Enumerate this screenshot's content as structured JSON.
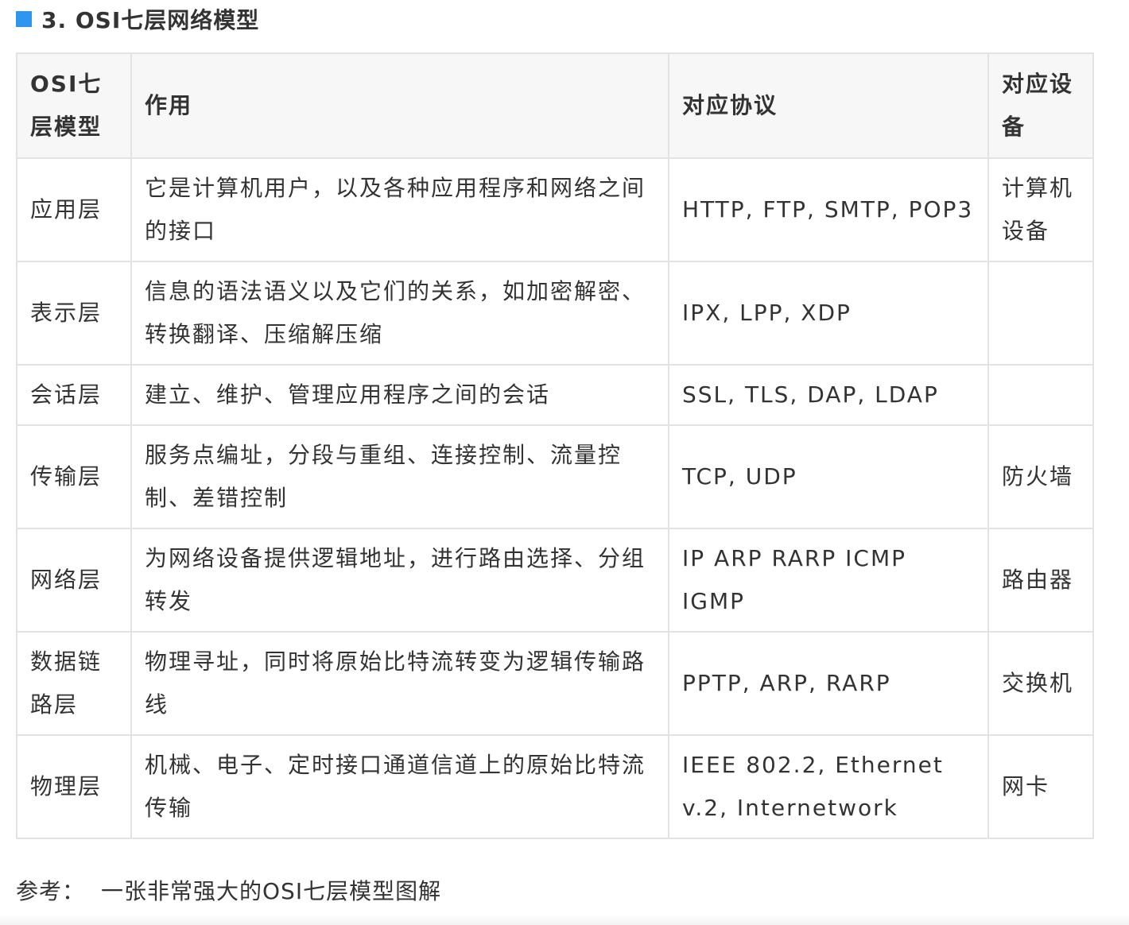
{
  "heading": {
    "title": "3. OSI七层网络模型",
    "accent_color": "#2f96ef"
  },
  "table": {
    "headers": [
      "OSI七层模型",
      "作用",
      "对应协议",
      "对应设备"
    ],
    "rows": [
      {
        "layer": "应用层",
        "role": "它是计算机用户，以及各种应用程序和网络之间的接口",
        "protocols": "HTTP, FTP, SMTP, POP3",
        "device": "计算机设备"
      },
      {
        "layer": "表示层",
        "role": "信息的语法语义以及它们的关系，如加密解密、转换翻译、压缩解压缩",
        "protocols": "IPX, LPP, XDP",
        "device": ""
      },
      {
        "layer": "会话层",
        "role": "建立、维护、管理应用程序之间的会话",
        "protocols": "SSL, TLS, DAP, LDAP",
        "device": ""
      },
      {
        "layer": "传输层",
        "role": "服务点编址，分段与重组、连接控制、流量控制、差错控制",
        "protocols": "TCP, UDP",
        "device": "防火墙"
      },
      {
        "layer": "网络层",
        "role": "为网络设备提供逻辑地址，进行路由选择、分组转发",
        "protocols": "IP ARP RARP ICMP IGMP",
        "device": "路由器"
      },
      {
        "layer": "数据链路层",
        "role": "物理寻址，同时将原始比特流转变为逻辑传输路线",
        "protocols": "PPTP, ARP, RARP",
        "device": "交换机"
      },
      {
        "layer": "物理层",
        "role": "机械、电子、定时接口通道信道上的原始比特流传输",
        "protocols": "IEEE 802.2, Ethernet v.2, Internetwork",
        "device": "网卡"
      }
    ]
  },
  "reference": {
    "label": "参考：",
    "link_text": "一张非常强大的OSI七层模型图解"
  }
}
